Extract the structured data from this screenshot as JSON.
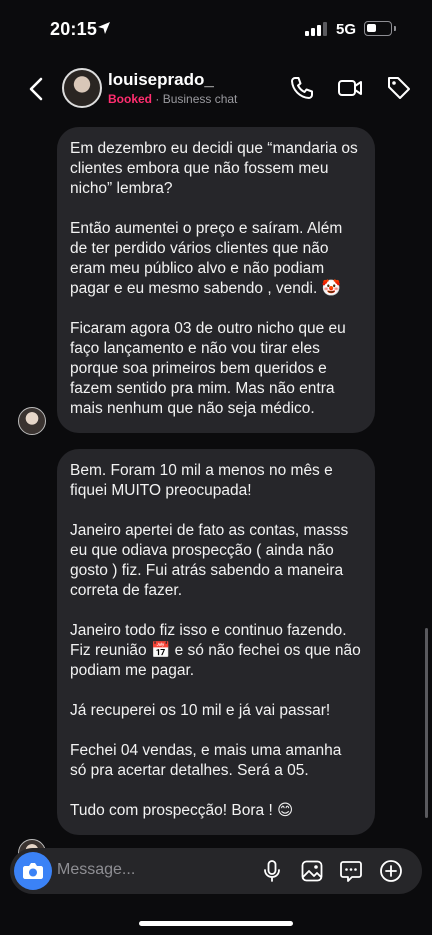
{
  "status_bar": {
    "time": "20:15",
    "network": "5G"
  },
  "header": {
    "username": "louiseprado_",
    "booked_label": "Booked",
    "separator": " · ",
    "chat_type": "Business chat"
  },
  "messages": [
    {
      "paragraphs": [
        "Em dezembro eu decidi que “mandaria os clientes embora que não fossem meu nicho” lembra?",
        "Então aumentei o preço e saíram. Além de ter perdido vários clientes que não eram meu público alvo  e não podiam pagar e eu mesmo sabendo , vendi. 🤡",
        "Ficaram agora 03 de outro nicho que eu faço lançamento e não vou tirar eles porque soa primeiros bem queridos e fazem sentido pra mim. Mas não entra mais nenhum que não seja médico."
      ]
    },
    {
      "paragraphs": [
        "Bem. Foram 10 mil a menos no mês e fiquei MUITO preocupada!",
        "Janeiro apertei de fato as contas, masss eu que odiava prospecção ( ainda não gosto ) fiz. Fui atrás sabendo a maneira correta de fazer.",
        "Janeiro todo fiz isso e continuo fazendo. Fiz reunião 📅 e só não fechei os que não podiam me pagar.",
        "Já recuperei os 10 mil e já vai passar!",
        "Fechei 04 vendas, e mais uma amanha só pra acertar detalhes. Será a 05.",
        "Tudo com prospecção! Bora ! 😊"
      ]
    }
  ],
  "composer": {
    "placeholder": "Message..."
  },
  "icons": {
    "back": "chevron-left-icon",
    "call": "phone-icon",
    "video": "video-icon",
    "tag": "tag-icon",
    "camera": "camera-icon",
    "mic": "microphone-icon",
    "gallery": "image-icon",
    "sticker": "sticker-icon",
    "plus": "plus-circle-icon"
  },
  "colors": {
    "booked": "#ff2d6f",
    "camera_button": "#3b82f6",
    "bubble": "#26262a"
  }
}
